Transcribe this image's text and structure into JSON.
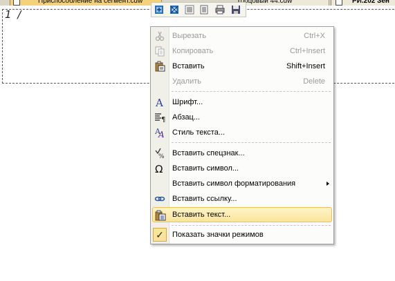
{
  "tabs": {
    "active_tab": "Приспособление на сегмент.cdw",
    "middle_tab": "торцовый 44.cdw",
    "right_tab": "РИ.202 Зен"
  },
  "document": {
    "text": "1 /"
  },
  "toolbar": {
    "buttons": [
      "insert-link-icon",
      "insert-object-icon",
      "align-icon",
      "list-icon",
      "print-icon",
      "save-icon"
    ]
  },
  "menu": {
    "cut": {
      "label": "Вырезать",
      "shortcut": "Ctrl+X"
    },
    "copy": {
      "label": "Копировать",
      "shortcut": "Ctrl+Insert"
    },
    "paste": {
      "label": "Вставить",
      "shortcut": "Shift+Insert"
    },
    "delete": {
      "label": "Удалить",
      "shortcut": "Delete"
    },
    "font": {
      "label": "Шрифт..."
    },
    "paragraph": {
      "label": "Абзац..."
    },
    "text_style": {
      "label": "Стиль текста..."
    },
    "insert_special": {
      "label": "Вставить спецзнак..."
    },
    "insert_symbol": {
      "label": "Вставить символ..."
    },
    "insert_format_symbol": {
      "label": "Вставить символ форматирования"
    },
    "insert_link": {
      "label": "Вставить ссылку..."
    },
    "insert_text": {
      "label": "Вставить текст..."
    },
    "show_modes": {
      "label": "Показать значки режимов",
      "checked": true
    }
  }
}
